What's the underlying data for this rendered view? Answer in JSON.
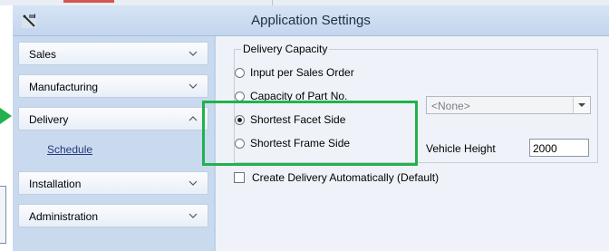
{
  "window": {
    "title": "Application Settings"
  },
  "nav": {
    "items": [
      {
        "label": "Sales",
        "chevron": "chevron-down-icon"
      },
      {
        "label": "Manufacturing",
        "chevron": "chevron-down-icon"
      },
      {
        "label": "Delivery",
        "chevron": "chevron-up-icon",
        "expanded": true,
        "subitems": [
          {
            "label": "Schedule"
          }
        ]
      },
      {
        "label": "Installation",
        "chevron": "chevron-down-icon"
      },
      {
        "label": "Administration",
        "chevron": "chevron-down-icon"
      }
    ]
  },
  "delivery_capacity": {
    "group_label": "Delivery Capacity",
    "options": [
      {
        "label": "Input per Sales Order",
        "selected": false
      },
      {
        "label": "Capacity of Part No.",
        "selected": false
      },
      {
        "label": "Shortest Facet Side",
        "selected": true
      },
      {
        "label": "Shortest Frame Side",
        "selected": false
      }
    ],
    "part_no_select": {
      "value": "<None>",
      "disabled": true
    },
    "vehicle_height": {
      "label": "Vehicle Height",
      "value": "2000"
    }
  },
  "create_delivery_auto": {
    "label": "Create Delivery Automatically (Default)",
    "checked": false
  },
  "colors": {
    "highlight": "#22b14c",
    "title_text": "#1e2f45",
    "link": "#243a78"
  }
}
